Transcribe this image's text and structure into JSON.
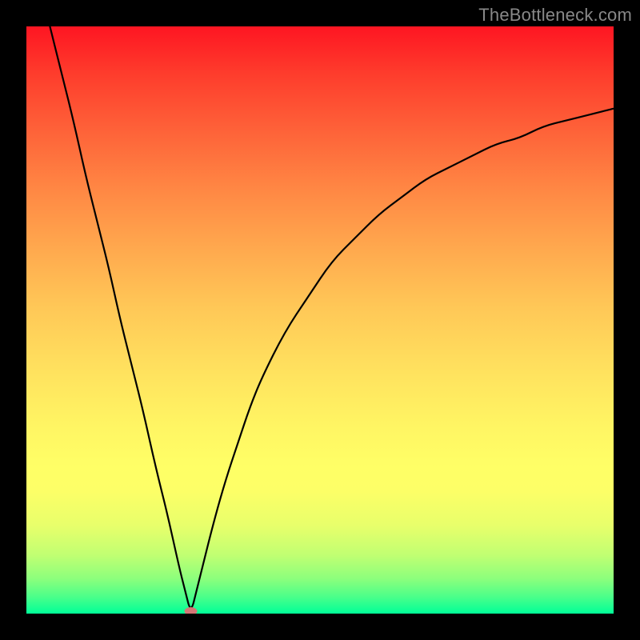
{
  "watermark": "TheBottleneck.com",
  "colors": {
    "frame": "#000000",
    "gradient_top": "#fe1522",
    "gradient_bottom": "#01ff98",
    "curve": "#000000",
    "marker": "#d47676"
  },
  "chart_data": {
    "type": "line",
    "title": "",
    "xlabel": "",
    "ylabel": "",
    "xlim": [
      0,
      100
    ],
    "ylim": [
      0,
      100
    ],
    "annotations": [
      {
        "text": "TheBottleneck.com",
        "position": "top-right"
      }
    ],
    "marker": {
      "x": 28,
      "y": 0,
      "color": "#d47676"
    },
    "series": [
      {
        "name": "bottleneck-curve",
        "x": [
          4,
          6,
          8,
          10,
          12,
          14,
          16,
          18,
          20,
          22,
          24,
          26,
          27,
          28,
          29,
          30,
          32,
          34,
          36,
          38,
          40,
          44,
          48,
          52,
          56,
          60,
          64,
          68,
          72,
          76,
          80,
          84,
          88,
          92,
          96,
          100
        ],
        "y": [
          100,
          92,
          84,
          75,
          67,
          59,
          50,
          42,
          34,
          25,
          17,
          8,
          4,
          0,
          4,
          8,
          16,
          23,
          29,
          35,
          40,
          48,
          54,
          60,
          64,
          68,
          71,
          74,
          76,
          78,
          80,
          81,
          83,
          84,
          85,
          86
        ]
      }
    ]
  }
}
